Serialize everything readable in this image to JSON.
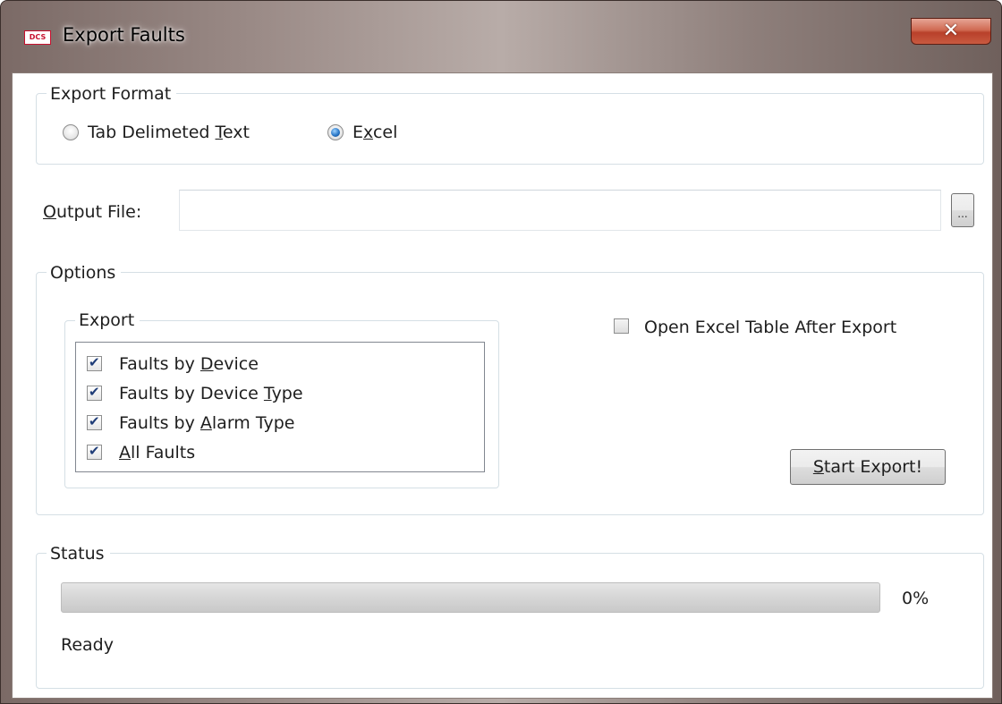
{
  "window": {
    "title": "Export Faults",
    "app_icon_text": "DCS",
    "close_glyph": "✕"
  },
  "export_format": {
    "legend": "Export Format",
    "options": [
      {
        "label": "Tab Delimeted ",
        "mnemonic": "T",
        "label_rest": "ext",
        "checked": false
      },
      {
        "label": "E",
        "mnemonic": "x",
        "label_rest": "cel",
        "checked": true
      }
    ]
  },
  "output_file": {
    "label_mnemonic": "O",
    "label_rest": "utput File:",
    "value": "",
    "browse_label": "..."
  },
  "options": {
    "legend": "Options",
    "export_group": {
      "legend": "Export",
      "items": [
        {
          "pre": "Faults by ",
          "mnemonic": "D",
          "post": "evice",
          "checked": true
        },
        {
          "pre": "Faults by Device ",
          "mnemonic": "T",
          "post": "ype",
          "checked": true
        },
        {
          "pre": "Faults by ",
          "mnemonic": "A",
          "post": "larm Type",
          "checked": true
        },
        {
          "pre": "",
          "mnemonic": "A",
          "post": "ll Faults",
          "checked": true
        }
      ]
    },
    "open_excel": {
      "label": "Open Excel Table After Export",
      "checked": false
    },
    "start_export": {
      "mnemonic": "S",
      "label_rest": "tart Export!"
    }
  },
  "status": {
    "legend": "Status",
    "progress_fraction": 0,
    "progress_text": "0%",
    "state_text": "Ready"
  },
  "colors": {
    "radio_selected": "#2a78c8",
    "checkmark": "#1f3d78",
    "close_button": "#c85a40"
  }
}
